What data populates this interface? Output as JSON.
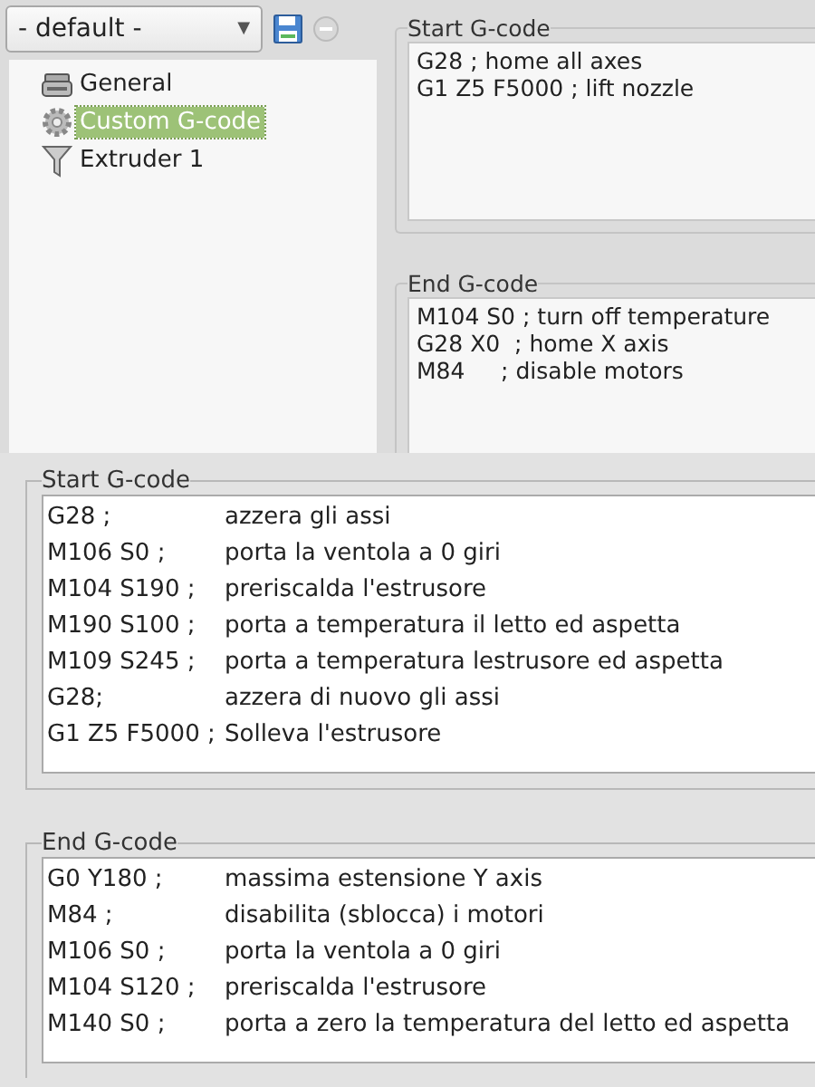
{
  "preset": {
    "value": "- default -",
    "arrow": "▼"
  },
  "tree": [
    {
      "label": "General",
      "kind": "printer",
      "selected": false
    },
    {
      "label": "Custom G-code",
      "kind": "gear",
      "selected": true
    },
    {
      "label": "Extruder 1",
      "kind": "funnel",
      "selected": false
    }
  ],
  "settings": [
    {
      "legend": "Start G-code",
      "lines": [
        "G28 ; home all axes",
        "G1 Z5 F5000 ; lift nozzle"
      ]
    },
    {
      "legend": "End G-code",
      "lines": [
        "M104 S0 ; turn off temperature",
        "G28 X0  ; home X axis",
        "M84     ; disable motors"
      ]
    }
  ],
  "detail": [
    {
      "legend": "Start G-code",
      "lines": [
        {
          "code": "G28 ;",
          "comment": "azzera gli assi"
        },
        {
          "code": "M106 S0 ;",
          "comment": "porta la ventola a 0 giri"
        },
        {
          "code": "M104 S190 ;",
          "comment": "preriscalda l'estrusore"
        },
        {
          "code": "M190 S100 ;",
          "comment": "porta a temperatura il letto ed aspetta"
        },
        {
          "code": "M109 S245 ;",
          "comment": "porta a temperatura lestrusore ed aspetta"
        },
        {
          "code": "G28;",
          "comment": "azzera di nuovo gli assi"
        },
        {
          "code": "G1 Z5 F5000 ;",
          "comment": "Solleva l'estrusore"
        }
      ]
    },
    {
      "legend": "End G-code",
      "lines": [
        {
          "code": "G0 Y180 ;",
          "comment": "massima estensione Y axis"
        },
        {
          "code": "M84 ;",
          "comment": "disabilita (sblocca) i motori"
        },
        {
          "code": "M106 S0 ;",
          "comment": "porta la ventola a 0 giri"
        },
        {
          "code": "M104 S120 ;",
          "comment": "preriscalda l'estrusore"
        },
        {
          "code": "M140 S0 ;",
          "comment": "porta a zero la temperatura del letto ed aspetta"
        }
      ]
    }
  ]
}
